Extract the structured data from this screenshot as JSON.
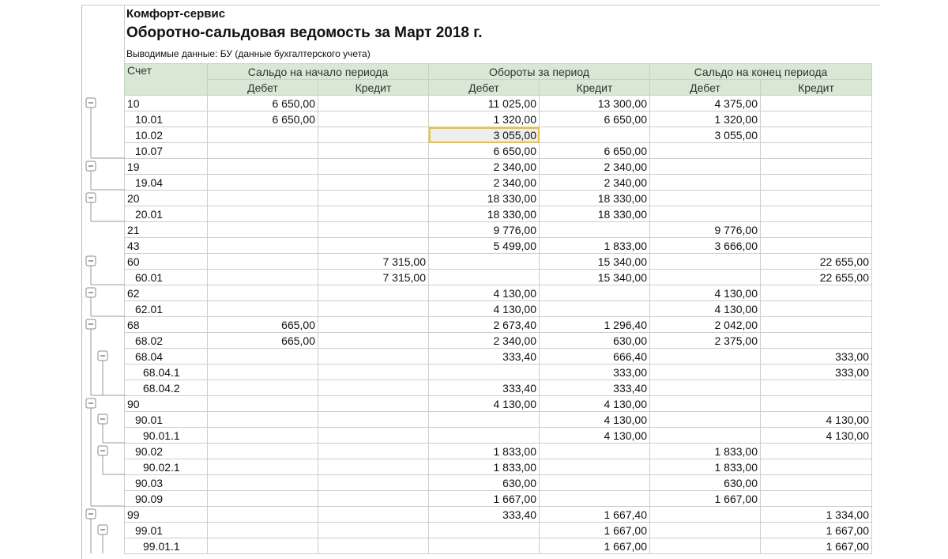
{
  "report": {
    "company": "Комфорт-сервис",
    "title": "Оборотно-сальдовая ведомость за Март 2018 г.",
    "params": "Выводимые данные:  БУ (данные бухгалтерского учета)"
  },
  "headers": {
    "account": "Счет",
    "opening": "Сальдо на начало периода",
    "turnover": "Обороты за период",
    "closing": "Сальдо на конец периода",
    "debit": "Дебет",
    "credit": "Кредит"
  },
  "colors": {
    "header_bg": "#d9e8d5",
    "grid": "#c5d3c8",
    "selection": "#f2c12e"
  },
  "selected": {
    "row": 2,
    "col": 2
  },
  "rows": [
    {
      "acc": "10",
      "lvl": 0,
      "grp": 3,
      "v": [
        "6 650,00",
        "",
        "11 025,00",
        "13 300,00",
        "4 375,00",
        ""
      ]
    },
    {
      "acc": "10.01",
      "lvl": 1,
      "v": [
        "6 650,00",
        "",
        "1 320,00",
        "6 650,00",
        "1 320,00",
        ""
      ]
    },
    {
      "acc": "10.02",
      "lvl": 1,
      "v": [
        "",
        "",
        "3 055,00",
        "",
        "3 055,00",
        ""
      ]
    },
    {
      "acc": "10.07",
      "lvl": 1,
      "v": [
        "",
        "",
        "6 650,00",
        "6 650,00",
        "",
        ""
      ]
    },
    {
      "acc": "19",
      "lvl": 0,
      "grp": 1,
      "v": [
        "",
        "",
        "2 340,00",
        "2 340,00",
        "",
        ""
      ]
    },
    {
      "acc": "19.04",
      "lvl": 1,
      "v": [
        "",
        "",
        "2 340,00",
        "2 340,00",
        "",
        ""
      ]
    },
    {
      "acc": "20",
      "lvl": 0,
      "grp": 1,
      "v": [
        "",
        "",
        "18 330,00",
        "18 330,00",
        "",
        ""
      ]
    },
    {
      "acc": "20.01",
      "lvl": 1,
      "v": [
        "",
        "",
        "18 330,00",
        "18 330,00",
        "",
        ""
      ]
    },
    {
      "acc": "21",
      "lvl": 0,
      "v": [
        "",
        "",
        "9 776,00",
        "",
        "9 776,00",
        ""
      ]
    },
    {
      "acc": "43",
      "lvl": 0,
      "v": [
        "",
        "",
        "5 499,00",
        "1 833,00",
        "3 666,00",
        ""
      ]
    },
    {
      "acc": "60",
      "lvl": 0,
      "grp": 1,
      "v": [
        "",
        "7 315,00",
        "",
        "15 340,00",
        "",
        "22 655,00"
      ]
    },
    {
      "acc": "60.01",
      "lvl": 1,
      "v": [
        "",
        "7 315,00",
        "",
        "15 340,00",
        "",
        "22 655,00"
      ]
    },
    {
      "acc": "62",
      "lvl": 0,
      "grp": 1,
      "v": [
        "",
        "",
        "4 130,00",
        "",
        "4 130,00",
        ""
      ]
    },
    {
      "acc": "62.01",
      "lvl": 1,
      "v": [
        "",
        "",
        "4 130,00",
        "",
        "4 130,00",
        ""
      ]
    },
    {
      "acc": "68",
      "lvl": 0,
      "grp": 4,
      "v": [
        "665,00",
        "",
        "2 673,40",
        "1 296,40",
        "2 042,00",
        ""
      ]
    },
    {
      "acc": "68.02",
      "lvl": 1,
      "v": [
        "665,00",
        "",
        "2 340,00",
        "630,00",
        "2 375,00",
        ""
      ]
    },
    {
      "acc": "68.04",
      "lvl": 1,
      "grp": 2,
      "v": [
        "",
        "",
        "333,40",
        "666,40",
        "",
        "333,00"
      ]
    },
    {
      "acc": "68.04.1",
      "lvl": 2,
      "v": [
        "",
        "",
        "",
        "333,00",
        "",
        "333,00"
      ]
    },
    {
      "acc": "68.04.2",
      "lvl": 2,
      "v": [
        "",
        "",
        "333,40",
        "333,40",
        "",
        ""
      ]
    },
    {
      "acc": "90",
      "lvl": 0,
      "grp": 6,
      "v": [
        "",
        "",
        "4 130,00",
        "4 130,00",
        "",
        ""
      ]
    },
    {
      "acc": "90.01",
      "lvl": 1,
      "grp": 1,
      "v": [
        "",
        "",
        "",
        "4 130,00",
        "",
        "4 130,00"
      ]
    },
    {
      "acc": "90.01.1",
      "lvl": 2,
      "v": [
        "",
        "",
        "",
        "4 130,00",
        "",
        "4 130,00"
      ]
    },
    {
      "acc": "90.02",
      "lvl": 1,
      "grp": 1,
      "v": [
        "",
        "",
        "1 833,00",
        "",
        "1 833,00",
        ""
      ]
    },
    {
      "acc": "90.02.1",
      "lvl": 2,
      "v": [
        "",
        "",
        "1 833,00",
        "",
        "1 833,00",
        ""
      ]
    },
    {
      "acc": "90.03",
      "lvl": 1,
      "v": [
        "",
        "",
        "630,00",
        "",
        "630,00",
        ""
      ]
    },
    {
      "acc": "90.09",
      "lvl": 1,
      "v": [
        "",
        "",
        "1 667,00",
        "",
        "1 667,00",
        ""
      ]
    },
    {
      "acc": "99",
      "lvl": 0,
      "grp": 9,
      "v": [
        "",
        "",
        "333,40",
        "1 667,40",
        "",
        "1 334,00"
      ]
    },
    {
      "acc": "99.01",
      "lvl": 1,
      "grp": 9,
      "v": [
        "",
        "",
        "",
        "1 667,00",
        "",
        "1 667,00"
      ]
    },
    {
      "acc": "99.01.1",
      "lvl": 2,
      "v": [
        "",
        "",
        "",
        "1 667,00",
        "",
        "1 667,00"
      ]
    }
  ]
}
